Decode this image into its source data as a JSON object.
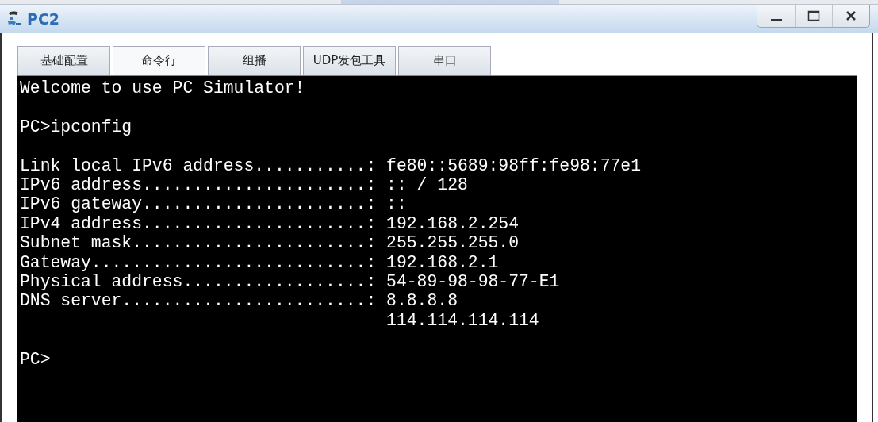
{
  "window": {
    "title": "PC2"
  },
  "tabs": [
    {
      "label": "基础配置",
      "selected": false
    },
    {
      "label": "命令行",
      "selected": true
    },
    {
      "label": "组播",
      "selected": false
    },
    {
      "label": "UDP发包工具",
      "selected": false
    },
    {
      "label": "串口",
      "selected": false
    }
  ],
  "terminal": {
    "blocks": [
      [
        "Welcome to use PC Simulator!"
      ],
      [
        "PC>ipconfig"
      ],
      [
        "Link local IPv6 address...........: fe80::5689:98ff:fe98:77e1",
        "IPv6 address......................: :: / 128",
        "IPv6 gateway......................: ::",
        "IPv4 address......................: 192.168.2.254",
        "Subnet mask.......................: 255.255.255.0",
        "Gateway...........................: 192.168.2.1",
        "Physical address..................: 54-89-98-98-77-E1",
        "DNS server........................: 8.8.8.8",
        "                                    114.114.114.114"
      ],
      [
        "PC>"
      ]
    ]
  }
}
